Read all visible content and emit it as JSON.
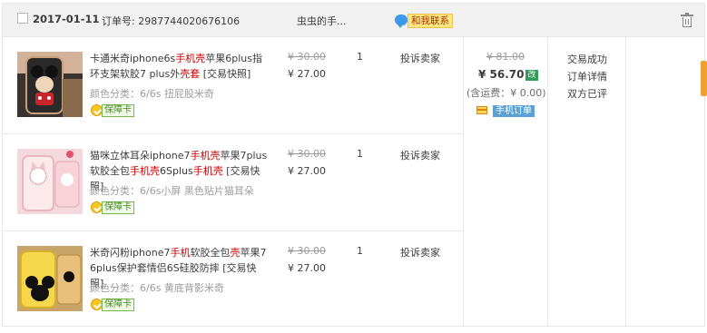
{
  "order": {
    "date": "2017-01-11",
    "order_number": "订单号: 2987744020676106",
    "seller": "虫虫的手...",
    "contact_label": "和我联系",
    "total_original": "¥ 81.00",
    "total": "¥ 56.70",
    "edit_tag": "改",
    "shipping": "(含运费：¥ 0.00)",
    "mobile_order_label": "手机订单",
    "status": [
      "交易成功",
      "订单详情",
      "双方已评"
    ]
  },
  "items": [
    {
      "title_parts": [
        "卡通米奇iphone6s",
        "手机壳",
        "苹果6plus指环支架软胶7 plus外",
        "壳套",
        " [交易快照]"
      ],
      "sku": "颜色分类：6/6s 扭屁股米奇",
      "badge": "保障卡",
      "price_original": "¥ 30.00",
      "price": "¥ 27.00",
      "qty": "1",
      "action": "投诉卖家"
    },
    {
      "title_parts": [
        "猫咪立体耳朵iphone7",
        "手机壳",
        "苹果7plus软胶全包",
        "手机壳",
        "6Splus",
        "手机壳",
        " [交易快照]"
      ],
      "sku": "颜色分类：6/6s小屏 黑色贴片猫耳朵",
      "badge": "保障卡",
      "price_original": "¥ 30.00",
      "price": "¥ 27.00",
      "qty": "1",
      "action": "投诉卖家"
    },
    {
      "title_parts": [
        "米奇闪粉iphone7",
        "手机",
        "软胶全包",
        "壳",
        "苹果7 6plus保护套情侣6S硅胶防摔 [交易快照]"
      ],
      "sku": "颜色分类：6/6s 黄底背影米奇",
      "badge": "保障卡",
      "price_original": "¥ 30.00",
      "price": "¥ 27.00",
      "qty": "1",
      "action": "投诉卖家"
    }
  ],
  "colors": {
    "highlight": "#c40000",
    "header_bg": "#f1f1f1",
    "contact_bg": "#ffe680",
    "badge_green": "#3e8f14",
    "mobile_blue": "#5aa2d6",
    "scroll_orange": "#f0a030"
  },
  "icons": {
    "checkbox": "checkbox-icon",
    "chat": "chat-bubble-icon",
    "delete": "trash-icon",
    "guarantee": "guarantee-coin-icon",
    "card": "card-icon"
  }
}
